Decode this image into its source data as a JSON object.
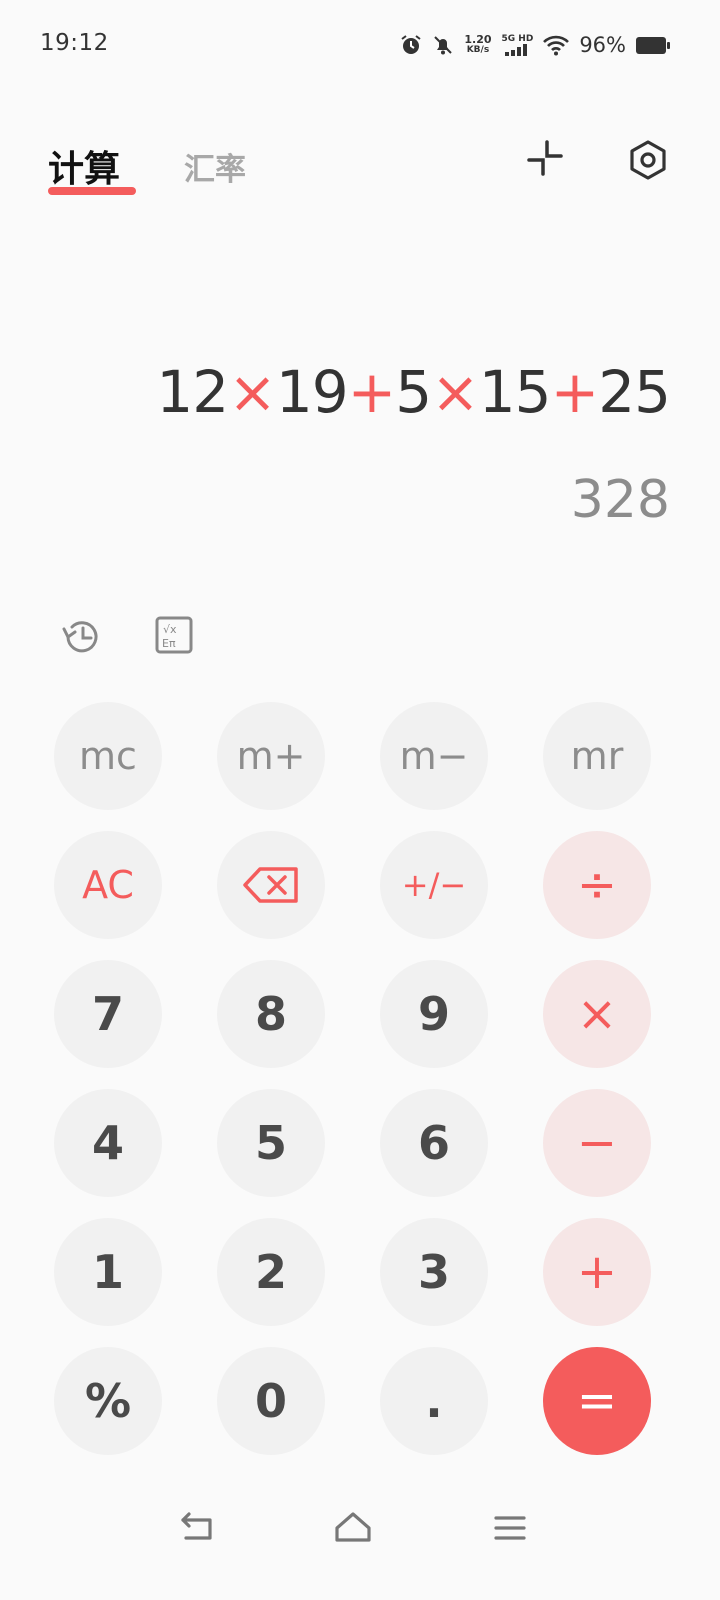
{
  "status_bar": {
    "time": "19:12",
    "net_speed_value": "1.20",
    "net_speed_unit": "KB/s",
    "network": "5G HD",
    "battery": "96%"
  },
  "tabs": [
    {
      "label": "计算",
      "active": true
    },
    {
      "label": "汇率",
      "active": false
    }
  ],
  "display": {
    "expression_parts": [
      {
        "text": "12",
        "type": "num"
      },
      {
        "text": "×",
        "type": "op"
      },
      {
        "text": "19",
        "type": "num"
      },
      {
        "text": "+",
        "type": "op"
      },
      {
        "text": "5",
        "type": "num"
      },
      {
        "text": "×",
        "type": "op"
      },
      {
        "text": "15",
        "type": "num"
      },
      {
        "text": "+",
        "type": "op"
      },
      {
        "text": "25",
        "type": "num"
      }
    ],
    "result": "328"
  },
  "keys": {
    "mc": "mc",
    "mplus": "m+",
    "mminus": "m−",
    "mr": "mr",
    "ac": "AC",
    "plusminus": "+/−",
    "divide": "÷",
    "seven": "7",
    "eight": "8",
    "nine": "9",
    "multiply": "×",
    "four": "4",
    "five": "5",
    "six": "6",
    "minus": "−",
    "one": "1",
    "two": "2",
    "three": "3",
    "plus": "+",
    "percent": "%",
    "zero": "0",
    "dot": ".",
    "equals": "="
  },
  "icons": {
    "history": "history-icon",
    "scientific": "scientific-mode-icon",
    "backspace": "backspace-icon",
    "compact": "compact-mode-icon",
    "settings": "settings-icon"
  },
  "colors": {
    "accent": "#f45c5c",
    "background": "#fafafa",
    "key_background": "#f1f1f1",
    "operator_key_background": "#f6e6e6"
  }
}
